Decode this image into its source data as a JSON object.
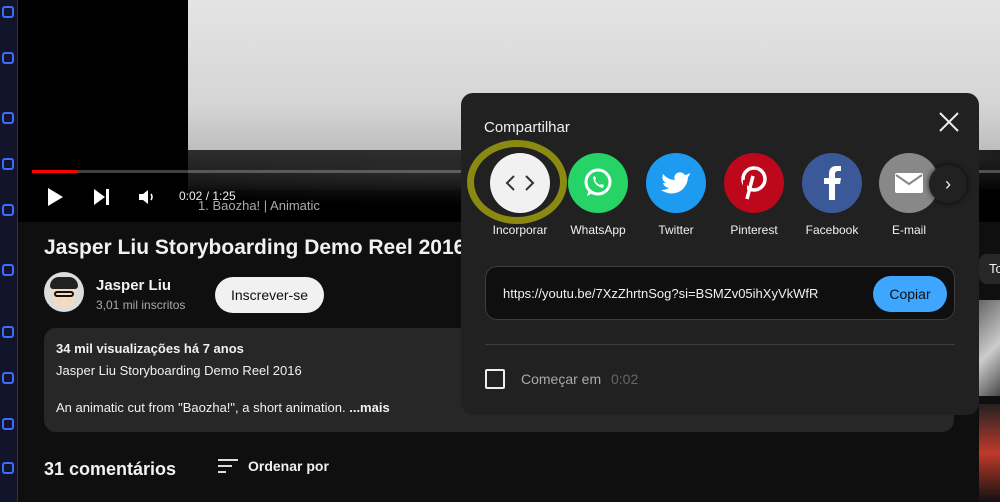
{
  "player": {
    "time": "0:02 / 1:25",
    "chapter": "1.  Baozha!  |  Animatic",
    "progress_fraction": 0.024
  },
  "video": {
    "title": "Jasper Liu Storyboarding Demo Reel 2016"
  },
  "channel": {
    "name": "Jasper Liu",
    "subscribers": "3,01 mil inscritos",
    "subscribe_label": "Inscrever-se"
  },
  "description": {
    "meta": "34 mil visualizações  há 7 anos",
    "line1": "Jasper Liu Storyboarding Demo Reel 2016",
    "line2": "An animatic cut from \"Baozha!\", a short animation.",
    "more": "...mais"
  },
  "comments": {
    "count_label": "31 comentários",
    "sort_label": "Ordenar por"
  },
  "right_panel": {
    "pill_label": "To"
  },
  "share": {
    "title": "Compartilhar",
    "items": [
      {
        "label": "Incorporar",
        "color": "#f1f1f1",
        "icon": "embed-icon"
      },
      {
        "label": "WhatsApp",
        "color": "#25d366",
        "icon": "whatsapp-icon"
      },
      {
        "label": "Twitter",
        "color": "#1d9bf0",
        "icon": "twitter-icon"
      },
      {
        "label": "Pinterest",
        "color": "#bd081c",
        "icon": "pinterest-icon"
      },
      {
        "label": "Facebook",
        "color": "#3b5998",
        "icon": "facebook-icon"
      },
      {
        "label": "E-mail",
        "color": "#888888",
        "icon": "email-icon"
      }
    ],
    "url": "https://youtu.be/7XzZhrtnSog?si=BSMZv05ihXyVkWfR",
    "copy_label": "Copiar",
    "start_label": "Começar em",
    "start_time": "0:02"
  },
  "colors": {
    "accent_blue": "#3ea6ff",
    "progress_red": "#ff0000",
    "annotation": "#8a8a12"
  }
}
